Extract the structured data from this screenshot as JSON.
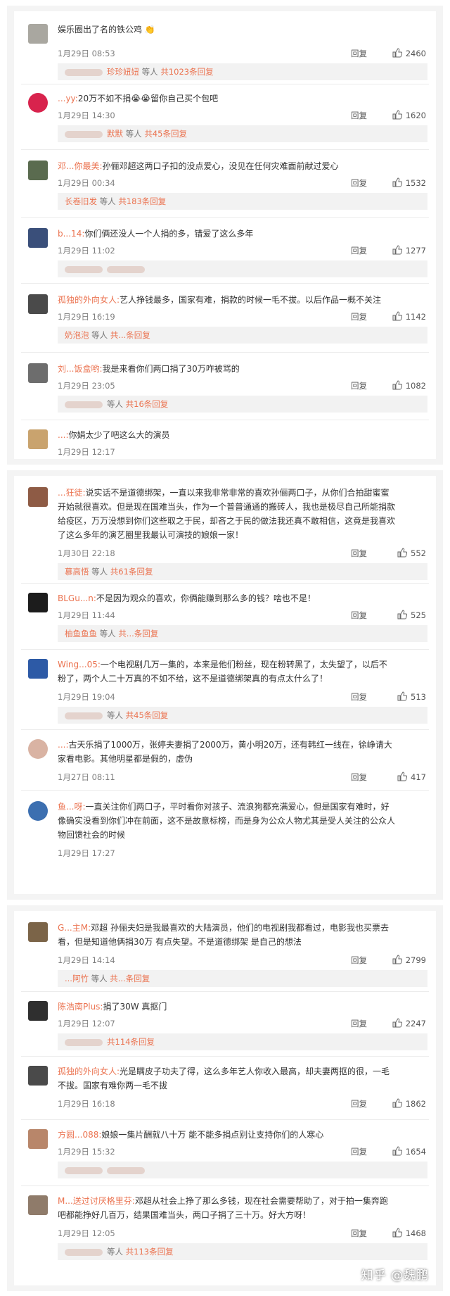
{
  "ui": {
    "reply_label": "回复",
    "wait_label": "等人",
    "thumb_icon": "thumbs-up-icon"
  },
  "panels": [
    {
      "comments": [
        {
          "name": "",
          "text": "娱乐圈出了名的铁公鸡",
          "date": "1月29日 08:53",
          "likes": "2460",
          "sub_left": "珍珍妞妞",
          "sub_mid": "等人",
          "sub_right": "共1023条回复"
        },
        {
          "name": "...yy:",
          "text": "20万不如不捐😭😭留你自己买个包吧",
          "date": "1月29日 14:30",
          "likes": "1620",
          "sub_left": "默默",
          "sub_mid": "等人",
          "sub_right": "共45条回复"
        },
        {
          "name": "邓...你最美:",
          "text": "孙俪邓超这两口子扣的没点爱心，没见在任何灾难面前献过爱心",
          "date": "1月29日 00:34",
          "likes": "1532",
          "sub_left": "长卷旧发",
          "sub_mid": "等人",
          "sub_right": "共183条回复"
        },
        {
          "name": "b...14:",
          "text": "你们俩还没人一个人捐的多，错爱了这么多年",
          "date": "1月29日 11:02",
          "likes": "1277",
          "sub_left": "",
          "sub_mid": "",
          "sub_right": ""
        },
        {
          "name": "孤独的外向女人:",
          "text": "艺人挣钱最多，国家有难，捐款的时候一毛不拔。以后作品一概不关注",
          "date": "1月29日 16:19",
          "likes": "1142",
          "sub_left": "奶泡泡",
          "sub_mid": "等人",
          "sub_right": "共...条回复"
        },
        {
          "name": "刘...饭盒哟:",
          "text": "我是来看你们两口捐了30万咋被骂的",
          "date": "1月29日 23:05",
          "likes": "1082",
          "sub_left": "",
          "sub_mid": "等人",
          "sub_right": "共16条回复"
        },
        {
          "name": "...:",
          "text": "你娟太少了吧这么大的演员",
          "date": "1月29日 12:17",
          "likes": "",
          "sub_left": "",
          "sub_mid": "",
          "sub_right": ""
        }
      ]
    },
    {
      "comments": [
        {
          "name": "...狂徒:",
          "text": "说实话不是道德绑架，一直以来我非常非常的喜欢孙俪两口子，从你们合拍甜蜜蜜开始就很喜欢。但是现在国难当头，作为一个普普通通的搬砖人，我也是极尽自己所能捐款给疫区，万万没想到你们这些取之于民，却吝之于民的做法我还真不敢相信，这竟是我喜欢了这么多年的演艺圈里我最认可演技的娘娘一家！",
          "date": "1月30日 22:18",
          "likes": "552",
          "sub_left": "慕高悟",
          "sub_mid": "等人",
          "sub_right": "共61条回复"
        },
        {
          "name": "BLGu...n:",
          "text": "不是因为观众的喜欢，你俩能赚到那么多的钱？啥也不是！",
          "date": "1月29日 11:44",
          "likes": "525",
          "sub_left": "柚鱼鱼鱼",
          "sub_mid": "等人",
          "sub_right": "共...条回复"
        },
        {
          "name": "Wing...05:",
          "text": "一个电视剧几万一集的，本来是他们粉丝，现在粉转黑了，太失望了，以后不粉了，两个人二十万真的不如不给，这不是道德绑架真的有点太什么了！",
          "date": "1月29日 19:04",
          "likes": "513",
          "sub_left": "",
          "sub_mid": "等人",
          "sub_right": "共45条回复"
        },
        {
          "name": "...:",
          "text": "古天乐捐了1000万，张婷夫妻捐了2000万，黄小明20万，还有韩红一线在，徐峥请大家看电影。其他明星都是假的，虚伪",
          "date": "1月27日 08:11",
          "likes": "417",
          "sub_left": "",
          "sub_mid": "",
          "sub_right": ""
        },
        {
          "name": "鱼...呀:",
          "text": "一直关注你们两口子，平时看你对孩子、流浪狗都充满爱心，但是国家有难时，好像确实没看到你们冲在前面，这不是故意标榜，而是身为公众人物尤其是受人关注的公众人物回馈社会的时候",
          "date": "1月29日 17:27",
          "likes": "",
          "sub_left": "",
          "sub_mid": "",
          "sub_right": ""
        }
      ]
    },
    {
      "comments": [
        {
          "name": "G...主M:",
          "text": "邓超 孙俪夫妇是我最喜欢的大陆演员，他们的电视剧我都看过，电影我也买票去看，但是知道他俩捐30万 有点失望。不是道德绑架 是自己的想法",
          "date": "1月29日 14:14",
          "likes": "2799",
          "sub_left": "...阿竹",
          "sub_mid": "等人",
          "sub_right": "共...条回复"
        },
        {
          "name": "陈浩南Plus:",
          "text": "捐了30W 真抠门",
          "date": "1月29日 12:07",
          "likes": "2247",
          "sub_left": "",
          "sub_mid": "",
          "sub_right": "共114条回复"
        },
        {
          "name": "孤独的外向女人:",
          "text": "光是瞒皮子功夫了得，这么多年艺人你收入最高，却夫妻两抠的很，一毛不拔。国家有难你两一毛不拔",
          "date": "1月29日 16:18",
          "likes": "1862",
          "sub_left": "",
          "sub_mid": "",
          "sub_right": ""
        },
        {
          "name": "方圆...088:",
          "text": "娘娘一集片酬就八十万 能不能多捐点别让支持你们的人寒心",
          "date": "1月29日 15:32",
          "likes": "1654",
          "sub_left": "",
          "sub_mid": "",
          "sub_right": ""
        },
        {
          "name": "M...送过讨厌格里芬:",
          "text": "邓超从社会上挣了那么多钱，现在社会需要帮助了，对于拍一集奔跑吧都能挣好几百万，结果国难当头，两口子捐了三十万。好大方呀！",
          "date": "1月29日 12:05",
          "likes": "1468",
          "sub_left": "",
          "sub_mid": "等人",
          "sub_right": "共113条回复"
        }
      ]
    }
  ],
  "watermark": "知乎 @魏鹏"
}
